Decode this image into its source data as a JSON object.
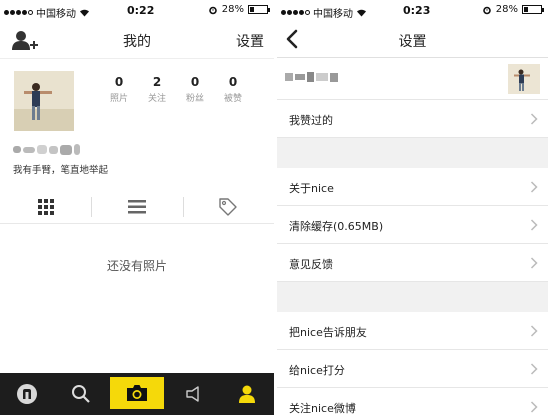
{
  "left": {
    "status": {
      "carrier": "中国移动",
      "time": "0:22",
      "battery": "28%",
      "battery_level": 0.28
    },
    "nav": {
      "title": "我的",
      "settings": "设置"
    },
    "stats": [
      {
        "value": "0",
        "label": "照片"
      },
      {
        "value": "2",
        "label": "关注"
      },
      {
        "value": "0",
        "label": "粉丝"
      },
      {
        "value": "0",
        "label": "被赞"
      }
    ],
    "bio": "我有手臂，笔直地举起",
    "empty_message": "还没有照片",
    "view_tabs": [
      "grid-icon",
      "list-icon",
      "tag-icon"
    ],
    "tabbar": [
      "home-icon",
      "search-icon",
      "camera-icon",
      "notification-icon",
      "profile-icon"
    ]
  },
  "right": {
    "status": {
      "carrier": "中国移动",
      "time": "0:23",
      "battery": "28%",
      "battery_level": 0.28
    },
    "nav": {
      "title": "设置"
    },
    "group1": [
      {
        "label": "我赞过的"
      }
    ],
    "group2": [
      {
        "label": "关于nice"
      },
      {
        "label": "清除缓存(0.65MB)"
      },
      {
        "label": "意见反馈"
      }
    ],
    "group3": [
      {
        "label": "把nice告诉朋友"
      },
      {
        "label": "给nice打分"
      },
      {
        "label": "关注nice微博"
      }
    ]
  },
  "colors": {
    "accent_yellow": "#f5d90a",
    "tabbar_bg": "#1d1d1d",
    "active_tab_icon": "#f5d90a"
  }
}
